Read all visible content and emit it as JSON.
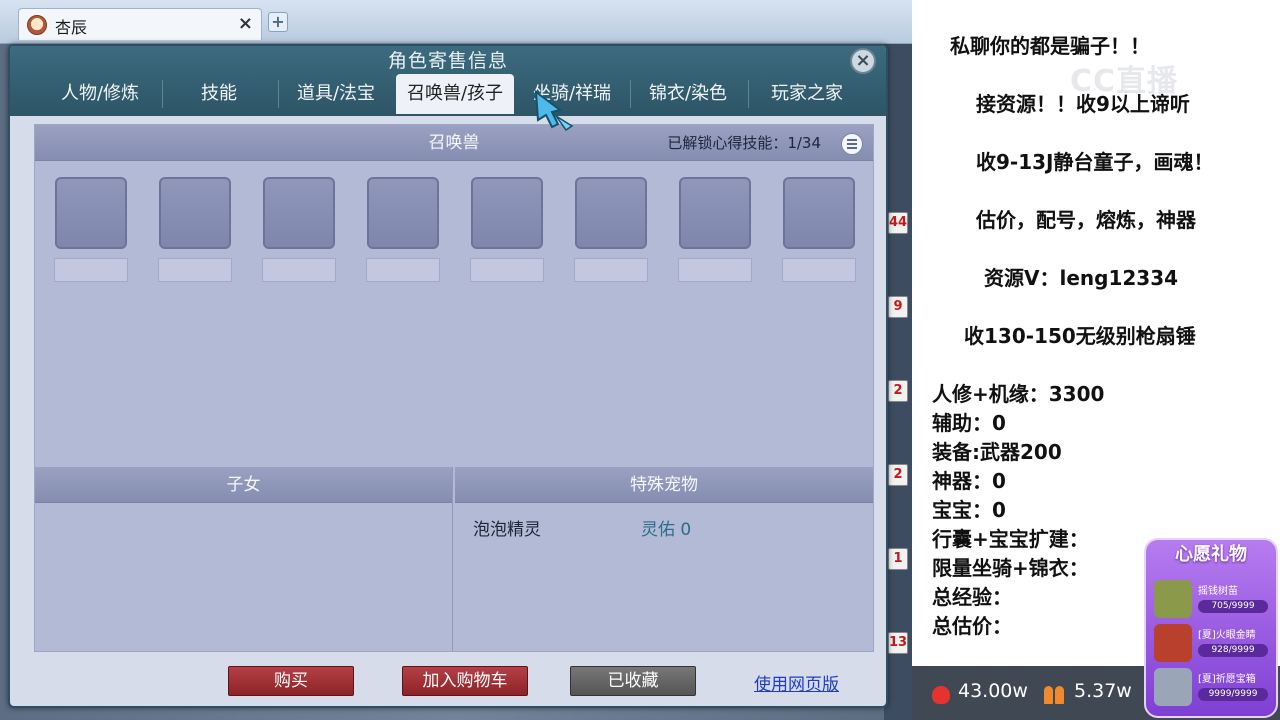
{
  "browser": {
    "tab_title": "杏辰",
    "tab_close": "×",
    "new_tab": "+"
  },
  "dialog": {
    "title": "角色寄售信息",
    "close": "×",
    "tabs": [
      {
        "label": "人物/修炼"
      },
      {
        "label": "技能"
      },
      {
        "label": "道具/法宝"
      },
      {
        "label": "召唤兽/孩子"
      },
      {
        "label": "坐骑/祥瑞"
      },
      {
        "label": "锦衣/染色"
      },
      {
        "label": "玩家之家"
      }
    ],
    "active_tab": 3,
    "summon": {
      "title": "召唤兽",
      "skill_label": "已解锁心得技能：1/34"
    },
    "children": {
      "title": "子女"
    },
    "special_pets": {
      "title": "特殊宠物",
      "pet_name": "泡泡精灵",
      "pet_value": "灵佑 0"
    },
    "buttons": {
      "buy": "购买",
      "add_cart": "加入购物车",
      "favorited": "已收藏",
      "web_version": "使用网页版"
    }
  },
  "side_markers": [
    "44",
    "9",
    "2",
    "2",
    "1",
    "13"
  ],
  "stream": {
    "notices": [
      "私聊你的都是骗子！！",
      "接资源！！收9以上谛听",
      "收9-13J静台童子，画魂！",
      "估价，配号，熔炼，神器",
      "资源V：leng12334",
      "收130-150无级别枪扇锤"
    ],
    "stats": [
      "人修+机缘：3300",
      "辅助：0",
      "装备:武器200",
      "神器：0",
      "宝宝：0",
      "行囊+宝宝扩建：",
      "限量坐骑+锦衣：",
      "总经验：",
      "总估价："
    ],
    "watermark": "CC直播",
    "heat": "43.00w",
    "fans": "5.37w",
    "wish": {
      "title": "心愿礼物",
      "gifts": [
        {
          "name": "摇钱树苗",
          "count": "705/9999",
          "progress": 0.0705,
          "color": "#8a9a4a"
        },
        {
          "name": "[夏]火眼金睛",
          "count": "928/9999",
          "progress": 0.0928,
          "color": "#b8402c"
        },
        {
          "name": "[夏]祈愿宝箱",
          "count": "9999/9999",
          "progress": 1.0,
          "color": "#9aa6b8"
        }
      ]
    }
  }
}
